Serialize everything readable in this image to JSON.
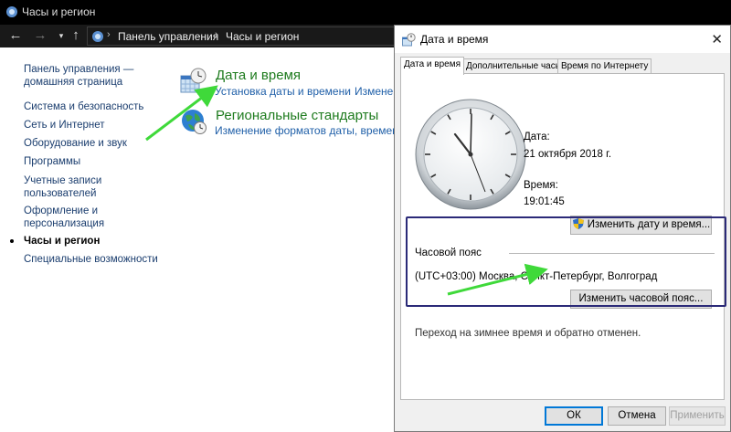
{
  "cp_window": {
    "title": "Часы и регион",
    "address": {
      "segments": [
        "Панель управления",
        "Часы и регион"
      ]
    }
  },
  "sidebar": {
    "home_line1": "Панель управления —",
    "home_line2": "домашняя страница",
    "items": [
      {
        "label": "Система и безопасность"
      },
      {
        "label": "Сеть и Интернет"
      },
      {
        "label": "Оборудование и звук"
      },
      {
        "label": "Программы"
      },
      {
        "label_line1": "Учетные записи",
        "label_line2": "пользователей"
      },
      {
        "label_line1": "Оформление и",
        "label_line2": "персонализация"
      },
      {
        "label": "Часы и регион"
      },
      {
        "label": "Специальные возможности"
      }
    ]
  },
  "main": {
    "categories": [
      {
        "title": "Дата и время",
        "links": [
          "Установка даты и времени",
          "Изменен"
        ],
        "icon": "calendar-clock-icon"
      },
      {
        "title": "Региональные стандарты",
        "links": [
          "Изменение форматов даты, времени и"
        ],
        "icon": "globe-clock-icon"
      }
    ]
  },
  "dialog": {
    "title": "Дата и время",
    "tabs": [
      "Дата и время",
      "Дополнительные часы",
      "Время по Интернету"
    ],
    "date_label": "Дата:",
    "date_value": "21 октября 2018 г.",
    "time_label": "Время:",
    "time_value": "19:01:45",
    "change_datetime_button": "Изменить дату и время...",
    "timezone_group": "Часовой пояс",
    "timezone_value": "(UTC+03:00) Москва, Санкт-Петербург, Волгоград",
    "change_timezone_button": "Изменить часовой пояс...",
    "dst_note": "Переход на зимнее время и обратно отменен.",
    "buttons": {
      "ok": "ОК",
      "cancel": "Отмена",
      "apply": "Применить"
    }
  },
  "colors": {
    "category_title": "#1e7b1e",
    "link": "#1f5fa8",
    "annotation_arrow": "#3fd93a",
    "highlight_box": "#2b2a78"
  }
}
